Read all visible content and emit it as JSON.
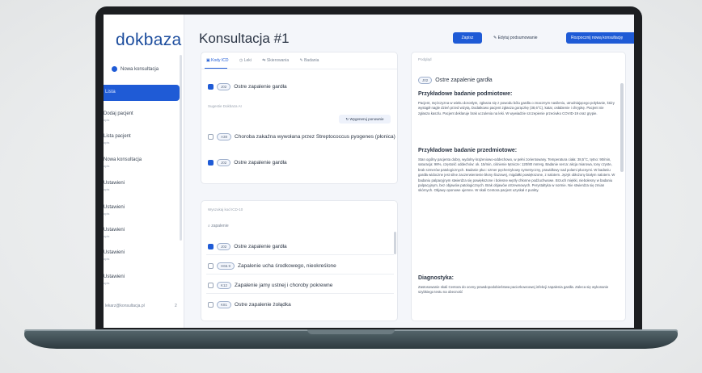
{
  "app": {
    "logo": "dokbaza",
    "page_title": "Konsultacja #1"
  },
  "sidebar": {
    "new_consultation": "Nowa konsultacja",
    "active_item": "Lista",
    "items": [
      {
        "label": "Dodaj pacjent",
        "sub": "opis"
      },
      {
        "label": "Lista pacjent",
        "sub": "opis"
      },
      {
        "label": "Nowa konsultacja",
        "sub": "opis"
      },
      {
        "label": "Ustawieni",
        "sub": "opis"
      },
      {
        "label": "Ustawieni",
        "sub": "opis"
      },
      {
        "label": "Ustawieni",
        "sub": "opis"
      },
      {
        "label": "Ustawieni",
        "sub": "opis"
      },
      {
        "label": "Ustawieni",
        "sub": "opis"
      }
    ],
    "user": "lekarz@konsultacja.pl",
    "user_count": "2"
  },
  "header": {
    "save_label": "Zapisz",
    "edit_label": "Edytuj podsumowanie",
    "new_label": "Rozpocznij nową konsultację"
  },
  "icd_panel": {
    "tabs": [
      "Kody ICD",
      "Leki",
      "Skierowania",
      "Badania"
    ],
    "selected_rows": [
      {
        "code": "J02",
        "label": "Ostre zapalenie gardła",
        "checked": true
      }
    ],
    "suggestion_label": "Sugestie Dokbaza AI",
    "regen_label": "Wygeneruj ponownie",
    "suggestions": [
      {
        "code": "A38",
        "label": "Choroba zakaźna wywołana przez Streptococcus pyogenes (płonica)",
        "checked": false
      },
      {
        "code": "J02",
        "label": "Ostre zapalenie gardła",
        "checked": true
      }
    ]
  },
  "search_panel": {
    "label": "Wyszukaj kod ICD-10",
    "search_value": "zapalenie",
    "results": [
      {
        "code": "J02",
        "label": "Ostre zapalenie gardła",
        "checked": true
      },
      {
        "code": "H66.9",
        "label": "Zapalenie ucha środkowego, nieokreślone",
        "checked": false
      },
      {
        "code": "K12",
        "label": "Zapalenie jamy ustnej i choroby pokrewne",
        "checked": false
      },
      {
        "code": "K81",
        "label": "Ostre zapalenie żołądka",
        "checked": false
      }
    ]
  },
  "details_panel": {
    "label": "Podgląd",
    "code": "J02",
    "title": "Ostre zapalenie gardła",
    "sections": [
      {
        "heading": "Przykładowe badanie podmiotowe:",
        "text": "Pacjent, mężczyzna w wieku dorosłym, zgłasza się z powodu bólu gardła o znacznym nasileniu, utrudniającego połykanie, który wystąpił nagle dzień przed wizytą. Dodatkowo pacjent zgłasza gorączkę (38,6°C), katar, osłabienie i chrypkę. Pacjent nie zgłasza kaszlu. Pacjent deklaruje brak uczulenia na leki. W wywiadzie szczepienie przeciwko COVID-19 oraz grypie."
      },
      {
        "heading": "Przykładowe badanie przedmiotowe:",
        "text": "Stan ogólny pacjenta dobry, wydolny krążeniowo-oddechowo, w pełni zorientowany. Temperatura ciała: 38,5°C, tętno: 90/min, saturacja: 98%, częstość oddechów: ok. 15/min, ciśnienie tętnicze: 120/80 mmHg. Badanie serca: akcja miarowa, tony czyste, brak szmerów patologicznych. Badanie płuc: szmer pęcherzykowy symetryczny, prawidłowy nad polami płucnymi. W badaniu gardła widoczne jest silne zaczerwienienie błony śluzowej, migdałki powiększone, z nalotem. Język obłożony białym nalotem. W badaniu palpacyjnym stwierdza się powiększone i bolesne węzły chłonne podżuchwowe. Brzuch miękki, niebolesny w badaniu palpacyjnym, bez objawów patologicznych. Brak objawów otrzewnowych. Perystaltyka w normie. Nie stwierdza się zmian skórnych. Objawy oponowe ujemne. W skali Centora pacjent uzyskał 4 punkty."
      },
      {
        "heading": "Diagnostyka:",
        "text": "Zastosowanie skali Centora do oceny prawdopodobieństwa paciorkowcowej infekcji zapalenia gardła. Zaleca się wykonanie szybkiego testu na obecność"
      }
    ]
  }
}
